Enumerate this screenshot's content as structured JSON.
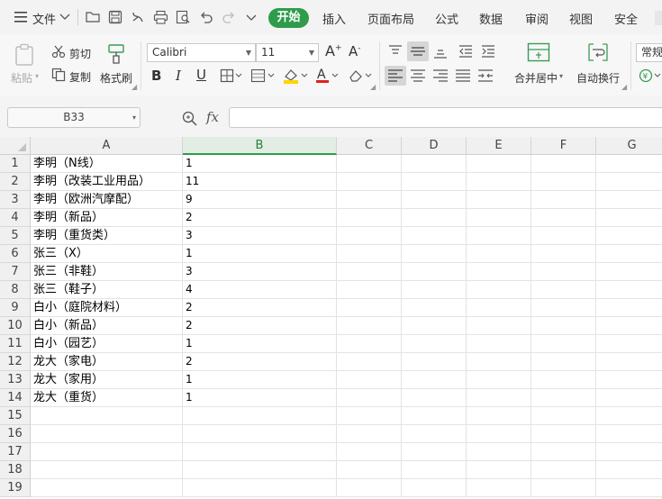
{
  "menubar": {
    "file_label": "文件",
    "tabs": [
      "开始",
      "插入",
      "页面布局",
      "公式",
      "数据",
      "审阅",
      "视图",
      "安全"
    ]
  },
  "ribbon": {
    "paste_label": "粘贴",
    "cut_label": "剪切",
    "copy_label": "复制",
    "format_painter_label": "格式刷",
    "font_name": "Calibri",
    "font_size": "11",
    "merge_center_label": "合并居中",
    "wrap_text_label": "自动换行",
    "number_format": "常规"
  },
  "formula_bar": {
    "name_box": "B33",
    "fx_label": "fx",
    "formula_value": ""
  },
  "sheet": {
    "columns": [
      "A",
      "B",
      "C",
      "D",
      "E",
      "F",
      "G"
    ],
    "selected_column": "B",
    "row_numbers": [
      "1",
      "2",
      "3",
      "4",
      "5",
      "6",
      "7",
      "8",
      "9",
      "10",
      "11",
      "12",
      "13",
      "14",
      "15",
      "16",
      "17",
      "18",
      "19"
    ],
    "rows": [
      [
        "李明（N线）",
        "1"
      ],
      [
        "李明（改装工业用品）",
        "11"
      ],
      [
        "李明（欧洲汽摩配）",
        "9"
      ],
      [
        "李明（新品）",
        "2"
      ],
      [
        "李明（重货类）",
        "3"
      ],
      [
        "张三（X）",
        "1"
      ],
      [
        "张三（非鞋）",
        "3"
      ],
      [
        "张三（鞋子）",
        "4"
      ],
      [
        "白小（庭院材料）",
        "2"
      ],
      [
        "白小（新品）",
        "2"
      ],
      [
        "白小（园艺）",
        "1"
      ],
      [
        "龙大（家电）",
        "2"
      ],
      [
        "龙大（家用）",
        "1"
      ],
      [
        "龙大（重货）",
        "1"
      ]
    ]
  },
  "colors": {
    "accent": "#2e9c4b",
    "header_bg": "#f0f0f0",
    "grid_line": "#e3e3e3"
  }
}
